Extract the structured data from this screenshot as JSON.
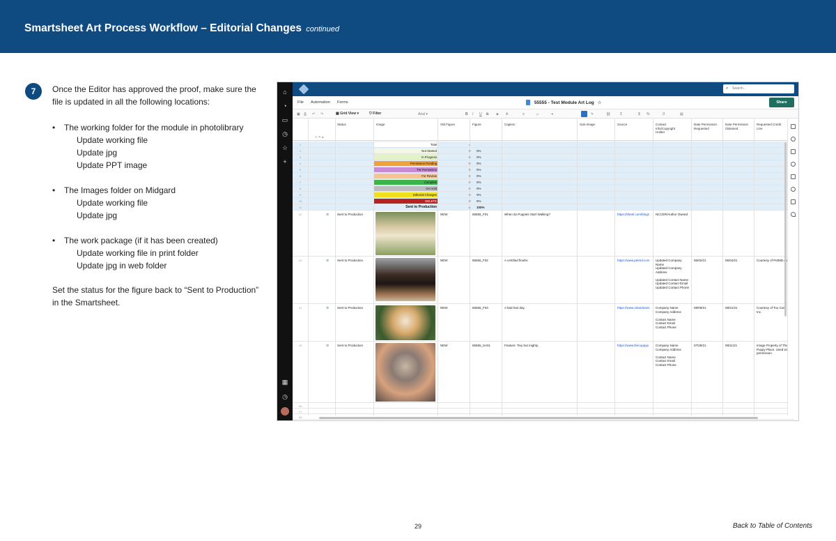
{
  "header": {
    "title": "Smartsheet Art Process Workflow – Editorial Changes",
    "subtitle": "continued"
  },
  "step": {
    "number": "7",
    "intro": "Once the Editor has approved the proof, make sure the file is updated in all the following locations:",
    "bullets": [
      {
        "text": "The working folder for the module in photolibrary",
        "subs": [
          "Update working file",
          "Update jpg",
          "Update PPT image"
        ]
      },
      {
        "text": "The Images folder on Midgard",
        "subs": [
          "Update working file",
          "Update jpg"
        ]
      },
      {
        "text": "The work package (if it has been created)",
        "subs": [
          "Update working file in print folder",
          "Update jpg in web folder"
        ]
      }
    ],
    "closing": "Set the status for the figure back to “Sent to Production” in the Smartsheet."
  },
  "footer": {
    "page_number": "29",
    "toc_link": "Back to Table of Contents"
  },
  "screenshot": {
    "search_placeholder": "Search...",
    "menu": [
      "File",
      "Automation",
      "Forms"
    ],
    "sheet_title": "55555 - Test Module Art Log",
    "share_label": "Share",
    "grid_view_label": "Grid View",
    "filter_label": "Filter",
    "font_label": "Arial",
    "columns": [
      "Status",
      "Image",
      "Old Figure",
      "Figure",
      "Caption",
      "Sub-Image",
      "Source",
      "Contact Info/Copyright Holder",
      "Date Permission Requested",
      "Date Permission Obtained",
      "Requested Credit Line"
    ],
    "summary_rows": [
      {
        "num": "1",
        "label": "Total",
        "count": "4",
        "pct": "",
        "color": "#ffffff"
      },
      {
        "num": "2",
        "label": "Not Started",
        "count": "0",
        "pct": "0%",
        "color": "#f3f8e3"
      },
      {
        "num": "3",
        "label": "In Progress",
        "count": "0",
        "pct": "0%",
        "color": "#e4f2c7"
      },
      {
        "num": "4",
        "label": "Permission Pending",
        "count": "0",
        "pct": "0%",
        "color": "#f0a13a"
      },
      {
        "num": "5",
        "label": "TW Permission",
        "count": "0",
        "pct": "0%",
        "color": "#c98ad6"
      },
      {
        "num": "6",
        "label": "For Review",
        "count": "0",
        "pct": "0%",
        "color": "#f6c393"
      },
      {
        "num": "7",
        "label": "Complete",
        "count": "0",
        "pct": "0%",
        "color": "#3db34a"
      },
      {
        "num": "8",
        "label": "On Hold",
        "count": "0",
        "pct": "0%",
        "color": "#bdbdbd"
      },
      {
        "num": "9",
        "label": "Editorial Changes",
        "count": "0",
        "pct": "0%",
        "color": "#f2e01c"
      },
      {
        "num": "10",
        "label": "DELETE",
        "count": "0",
        "pct": "0%",
        "color": "#b42424"
      },
      {
        "num": "11",
        "label": "Sent to Production",
        "count": "4",
        "pct": "100%",
        "color": "#dfeef9"
      }
    ],
    "data_rows": [
      {
        "num": "12",
        "status": "Sent to Production",
        "old_figure": "NEW",
        "figure": "55555_F01",
        "caption": "When do Puppies Start Walking?",
        "source": "https://kheel.com/blogs",
        "contact": "NCCER/Author Owned",
        "date_req": "",
        "date_obt": "",
        "credit": ""
      },
      {
        "num": "13",
        "status": "Sent to Production",
        "old_figure": "NEW",
        "figure": "55555_F02",
        "caption": "A certified floofer.",
        "source": "https://www.petmd.com",
        "contact": "Updated Company Name\nUpdated Company Address\n\nUpdated Contact Name\nUpdated Contact Email\nUpdated Contact Phone",
        "date_req": "06/02/21",
        "date_obt": "06/04/21",
        "credit": "Courtesy of PetMD.com"
      },
      {
        "num": "14",
        "status": "Sent to Production",
        "old_figure": "NEW",
        "figure": "55555_F03",
        "caption": "A bad hair day.",
        "source": "https://www.orlandosen",
        "contact": "Company Name\nCompany Address\n\nContact Name\nContact Email\nContact Phone",
        "date_req": "08/09/21",
        "date_obt": "08/21/21",
        "credit": "Courtesy of Too Cute, Inc."
      },
      {
        "num": "15",
        "status": "Sent to Production",
        "old_figure": "NEW",
        "figure": "55555_SA01",
        "caption": "Feature: Tiny but mighty.",
        "source": "https://www.thecuppyp",
        "contact": "Company Name\nCompany Address\n\nContact Name\nContact Email\nContact Phone",
        "date_req": "07/28/21",
        "date_obt": "08/11/21",
        "credit": "Image Property of The Puppy Place. Used with permission."
      }
    ],
    "empty_rows": [
      "16",
      "17",
      "18"
    ]
  }
}
